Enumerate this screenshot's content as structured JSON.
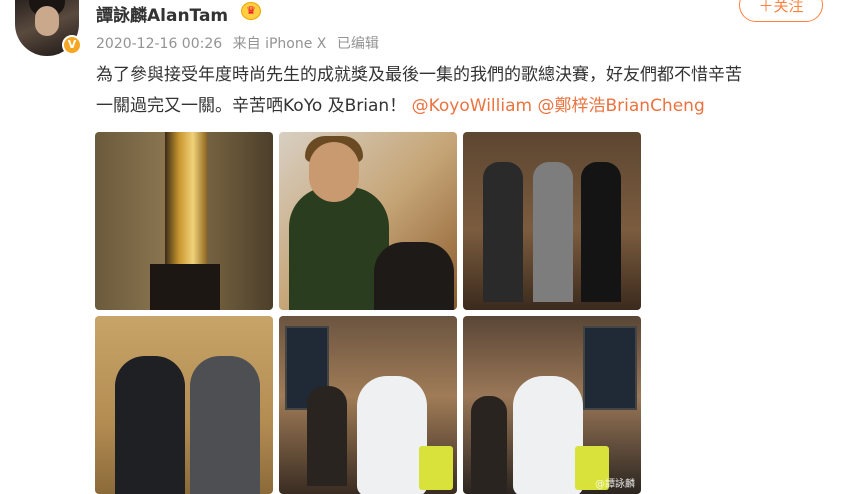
{
  "user": {
    "name": "譚詠麟AlanTam",
    "verified_badge": "V"
  },
  "post": {
    "date": "2020-12-16 00:26",
    "source": "来自 iPhone X",
    "edited": "已编辑",
    "text_line1": "為了參與接受年度時尚先生的成就獎及最後一集的我們的歌總決賽，好友們都不惜辛苦",
    "text_line2": "一關過完又一關。辛苦哂KoYo 及Brian！",
    "mention1": "@KoyoWilliam",
    "mention2": "@鄭梓浩BrianCheng"
  },
  "follow_button": {
    "label": "＋关注"
  },
  "photos": [
    {
      "name": "trophy-photo"
    },
    {
      "name": "hair-styling-photo"
    },
    {
      "name": "three-men-photo"
    },
    {
      "name": "two-men-trophy-photo"
    },
    {
      "name": "covid-test-photo-1"
    },
    {
      "name": "covid-test-photo-2"
    }
  ],
  "watermark": "@譚詠麟"
}
